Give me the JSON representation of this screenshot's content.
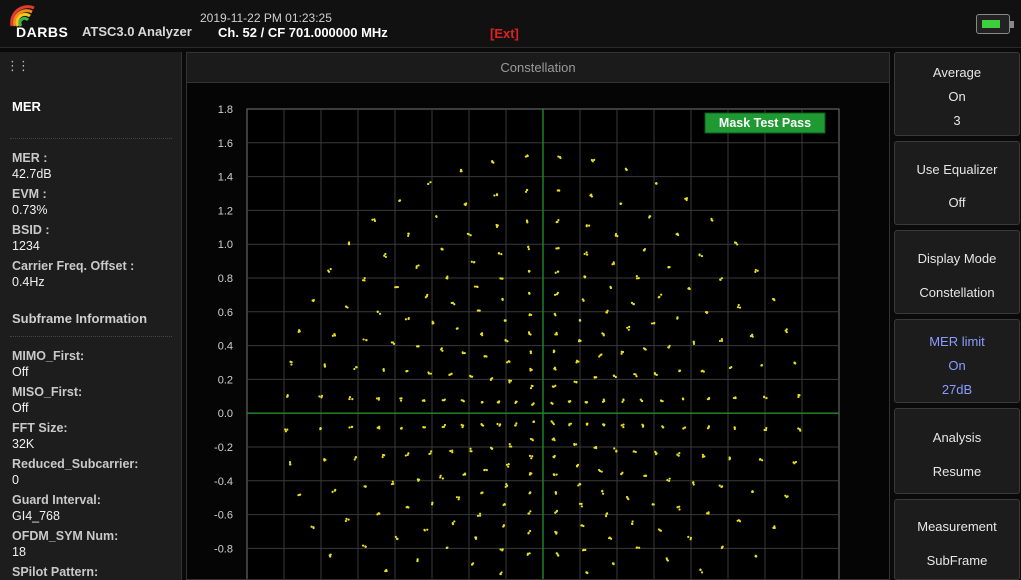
{
  "header": {
    "logo_text": "DARBS",
    "app_title": "ATSC3.0 Analyzer",
    "datetime": "2019-11-22 PM 01:23:25",
    "channel": "Ch. 52 / CF 701.000000 MHz",
    "ext_label": "[Ext]"
  },
  "left": {
    "title": "MER",
    "metrics": [
      {
        "key": "MER :",
        "value": "42.7dB"
      },
      {
        "key": "EVM :",
        "value": "0.73%"
      },
      {
        "key": "BSID :",
        "value": "1234"
      },
      {
        "key": "Carrier Freq. Offset :",
        "value": "0.4Hz"
      }
    ],
    "subframe_title": "Subframe Information",
    "subframe": [
      {
        "key": "MIMO_First:",
        "value": "Off"
      },
      {
        "key": "MISO_First:",
        "value": "Off"
      },
      {
        "key": "FFT Size:",
        "value": "32K"
      },
      {
        "key": "Reduced_Subcarrier:",
        "value": "0"
      },
      {
        "key": "Guard Interval:",
        "value": "GI4_768"
      },
      {
        "key": "OFDM_SYM Num:",
        "value": "18"
      },
      {
        "key": "SPilot Pattern:",
        "value": ""
      }
    ]
  },
  "center": {
    "title": "Constellation",
    "mask_label": "Mask Test Pass"
  },
  "right_buttons": [
    {
      "name": "average",
      "lines": [
        "Average",
        "On",
        "3"
      ]
    },
    {
      "name": "use-equalizer",
      "lines": [
        "Use Equalizer",
        "Off"
      ]
    },
    {
      "name": "display-mode",
      "lines": [
        "Display Mode",
        "Constellation"
      ]
    },
    {
      "name": "mer-limit",
      "lines": [
        "MER limit",
        "On",
        "27dB"
      ]
    },
    {
      "name": "analysis",
      "lines": [
        "Analysis",
        "Resume"
      ]
    },
    {
      "name": "measurement",
      "lines": [
        "Measurement",
        "SubFrame"
      ]
    }
  ],
  "colors": {
    "dots": "#e8e020",
    "mask_pass": "#1f9a32",
    "axis_green": "#1f8a2a",
    "grid": "#3a3a3a",
    "mer_limit_text": "#8a9cff",
    "ext": "#e02020"
  },
  "chart_data": {
    "type": "scatter",
    "title": "",
    "xlabel": "",
    "ylabel": "",
    "ylim": [
      -0.9,
      1.8
    ],
    "y_ticks": [
      "1.8",
      "1.6",
      "1.4",
      "1.2",
      "1.0",
      "0.8",
      "0.6",
      "0.4",
      "0.2",
      "0.0",
      "-0.2",
      "-0.4",
      "-0.6",
      "-0.8"
    ],
    "grid": true,
    "legend": "none",
    "annotation": "Mask Test Pass",
    "constellation": {
      "rings": [
        {
          "r": 0.08,
          "n": 4
        },
        {
          "r": 0.17,
          "n": 8
        },
        {
          "r": 0.27,
          "n": 12
        },
        {
          "r": 0.37,
          "n": 16
        },
        {
          "r": 0.48,
          "n": 20
        },
        {
          "r": 0.59,
          "n": 24
        },
        {
          "r": 0.71,
          "n": 28
        },
        {
          "r": 0.84,
          "n": 32
        },
        {
          "r": 0.98,
          "n": 36
        },
        {
          "r": 1.14,
          "n": 40
        },
        {
          "r": 1.32,
          "n": 44
        },
        {
          "r": 1.52,
          "n": 48
        }
      ]
    }
  }
}
